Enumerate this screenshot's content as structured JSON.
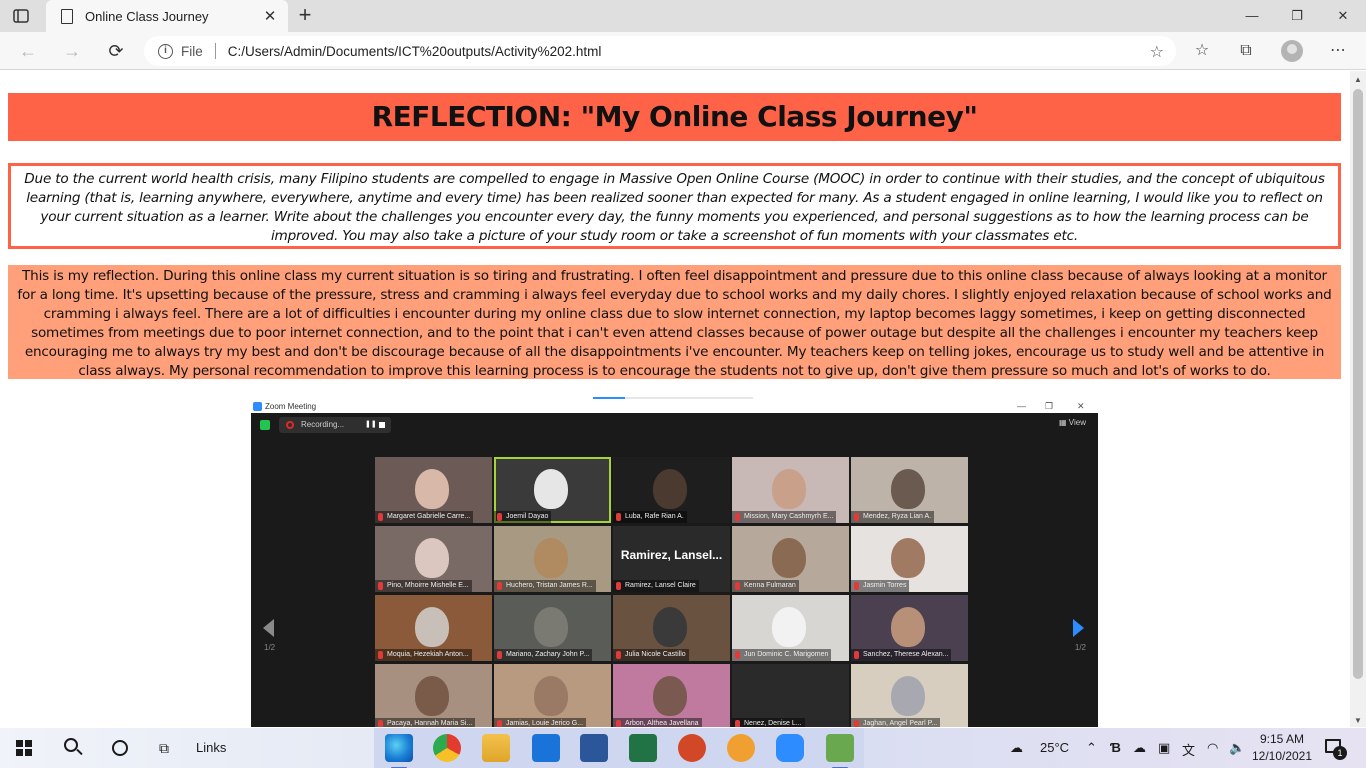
{
  "browser": {
    "tab_title": "Online Class Journey",
    "tab_close": "✕",
    "new_tab": "+",
    "file_label": "File",
    "url": "C:/Users/Admin/Documents/ICT%20outputs/Activity%202.html",
    "window_controls": {
      "minimize": "—",
      "maximize": "❐",
      "close": "✕"
    },
    "toolbar_icons": [
      "back-icon",
      "forward-icon",
      "refresh-icon",
      "favorites-star-icon",
      "collections-icon",
      "browser-essentials-icon",
      "profile-icon",
      "more-icon"
    ]
  },
  "page": {
    "title": "REFLECTION: \"My Online Class Journey\"",
    "prompt": "Due to the current world health crisis, many Filipino students are compelled to engage in Massive Open Online Course (MOOC) in order to continue with their studies, and the concept of ubiquitous learning (that is, learning anywhere, everywhere, anytime and every time) has been realized sooner than expected for many. As a student engaged in online learning, I would like you to reflect on your current situation as a learner. Write about the challenges you encounter every day, the funny moments you experienced, and personal suggestions as to how the learning process can be improved. You may also take a picture of your study room or take a screenshot of fun moments with your classmates etc.",
    "reflection": "This is my reflection. During this online class my current situation is so tiring and frustrating. I often feel disappointment and pressure due to this online class because of always looking at a monitor for a long time. It's upsetting because of the pressure, stress and cramming i always feel everyday due to school works and my daily chores. I slightly enjoyed relaxation because of school works and cramming i always feel. There are a lot of difficulties i encounter during my online class due to slow internet connection, my laptop becomes laggy sometimes, i keep on getting disconnected sometimes from meetings due to poor internet connection, and to the point that i can't even attend classes because of power outage but despite all the challenges i encounter my teachers keep encouraging me to always try my best and don't be discourage because of all the disappointments i've encounter. My teachers keep on telling jokes, encourage us to study well and be attentive in class always. My personal recommendation to improve this learning process is to encourage the students not to give up, don't give them pressure so much and lot's of works to do."
  },
  "zoom": {
    "window_title": "Zoom Meeting",
    "recording_label": "Recording...",
    "view_label": "View",
    "page_left": "1/2",
    "page_right": "1/2",
    "participants": [
      {
        "name": "Margaret Gabrielle Carre...",
        "bg": "#6b5a56",
        "face": "#d8b8a8"
      },
      {
        "name": "Joemil Dayao",
        "bg": "#3a3a3a",
        "face": "#e6e6e6"
      },
      {
        "name": "Luba, Rafe Rian A.",
        "bg": "#1e1e1e",
        "face": "#4a3a30"
      },
      {
        "name": "Mission, Mary Cashmyrh E...",
        "bg": "#c8b8b6",
        "face": "#c9a08a"
      },
      {
        "name": "Mendez, Ryza Lian A.",
        "bg": "#bdb3a8",
        "face": "#6a5a50"
      },
      {
        "name": "Pino, Mhoirre Mishelle E...",
        "bg": "#7a6a66",
        "face": "#dcc6c0"
      },
      {
        "name": "Huchero, Tristan James R...",
        "bg": "#a89a82",
        "face": "#b08a60"
      },
      {
        "name": "Ramirez, Lansel Claire",
        "bg": "#2a2a2a",
        "face": "",
        "big": "Ramirez,  Lansel..."
      },
      {
        "name": "Kenna Fulmaran",
        "bg": "#b6a89a",
        "face": "#8a6a52"
      },
      {
        "name": "Jasmin Torres",
        "bg": "#e6e2e0",
        "face": "#a07a62"
      },
      {
        "name": "Moquia, Hezekiah Anton...",
        "bg": "#8a5a3a",
        "face": "#c8c0b8"
      },
      {
        "name": "Mariano, Zachary John P...",
        "bg": "#5a5c58",
        "face": "#7a7a72"
      },
      {
        "name": "Julia Nicole Castillo",
        "bg": "#6a5240",
        "face": "#3a3a3a"
      },
      {
        "name": "Jun Dominic C. Marigomen",
        "bg": "#d8d6d2",
        "face": "#f2f2f2"
      },
      {
        "name": "Sanchez, Therese Alexan...",
        "bg": "#4a4050",
        "face": "#b89078"
      },
      {
        "name": "Pacaya, Hannah Maria Si...",
        "bg": "#a89080",
        "face": "#7a5a48"
      },
      {
        "name": "Jamias, Louie Jerico G...",
        "bg": "#b89a80",
        "face": "#9a7a64"
      },
      {
        "name": "Arbon, Althea Javellana",
        "bg": "#c07aa0",
        "face": "#7a5a50"
      },
      {
        "name": "Nenez, Denise L...",
        "bg": "#2a2a2a",
        "face": ""
      },
      {
        "name": "Jaghan, Angel Pearl P...",
        "bg": "#d8cec0",
        "face": "#a8a8b0"
      }
    ]
  },
  "taskbar": {
    "links_label": "Links",
    "apps": [
      "edge-icon",
      "chrome-icon",
      "file-explorer-icon",
      "mail-icon",
      "word-icon",
      "excel-icon",
      "powerpoint-icon",
      "brave-icon",
      "zoom-icon",
      "notepad-icon"
    ],
    "weather_temp": "25°C",
    "time": "9:15 AM",
    "date": "12/10/2021",
    "notification_count": "1"
  }
}
